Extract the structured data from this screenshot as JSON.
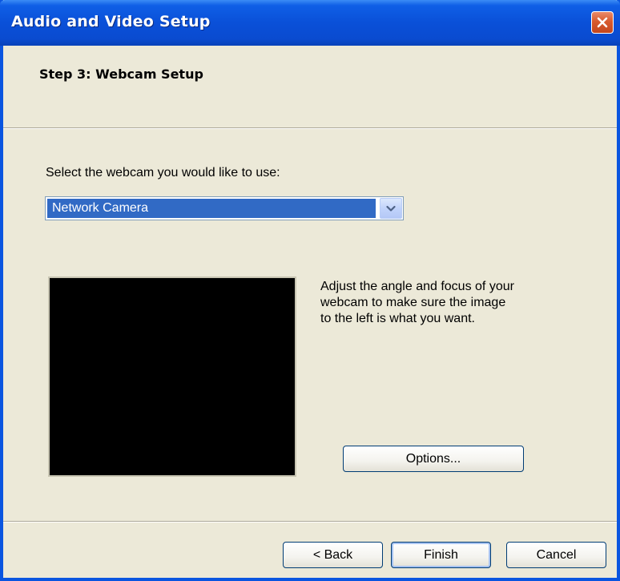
{
  "window": {
    "title": "Audio and Video Setup"
  },
  "header": {
    "step_title": "Step 3: Webcam Setup"
  },
  "main": {
    "select_label": "Select the webcam you would like to use:",
    "webcam_select": {
      "selected": "Network Camera"
    },
    "instructions": "Adjust the angle and focus of your\nwebcam to make sure the image\nto the left is what you want.",
    "options_label": "Options..."
  },
  "footer": {
    "back_label": "< Back",
    "finish_label": "Finish",
    "cancel_label": "Cancel"
  },
  "icons": {
    "close": "close-icon",
    "dropdown": "chevron-down-icon"
  },
  "colors": {
    "titlebar": "#0a50d8",
    "close_button": "#d85a2e",
    "selection": "#316ac5",
    "dialog_background": "#ece9d8",
    "preview_background": "#000000"
  }
}
